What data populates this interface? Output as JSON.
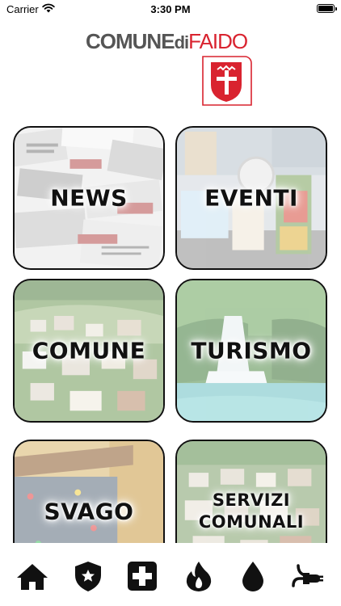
{
  "status_bar": {
    "carrier": "Carrier",
    "time": "3:30 PM"
  },
  "header": {
    "logo_part1": "COMUNE",
    "logo_part2": "di",
    "logo_part3": "FAIDO"
  },
  "tiles": [
    {
      "label": "NEWS"
    },
    {
      "label": "EVENTI"
    },
    {
      "label": "COMUNE"
    },
    {
      "label": "TURISMO"
    },
    {
      "label": "SVAGO"
    },
    {
      "label_line1": "SERVIZI",
      "label_line2": "COMUNALI"
    }
  ],
  "tab_bar": {
    "icons": [
      "home-icon",
      "police-badge-icon",
      "first-aid-icon",
      "fire-icon",
      "water-drop-icon",
      "electric-plug-icon"
    ]
  },
  "colors": {
    "accent_red": "#d9232f",
    "text_dark": "#111111"
  }
}
